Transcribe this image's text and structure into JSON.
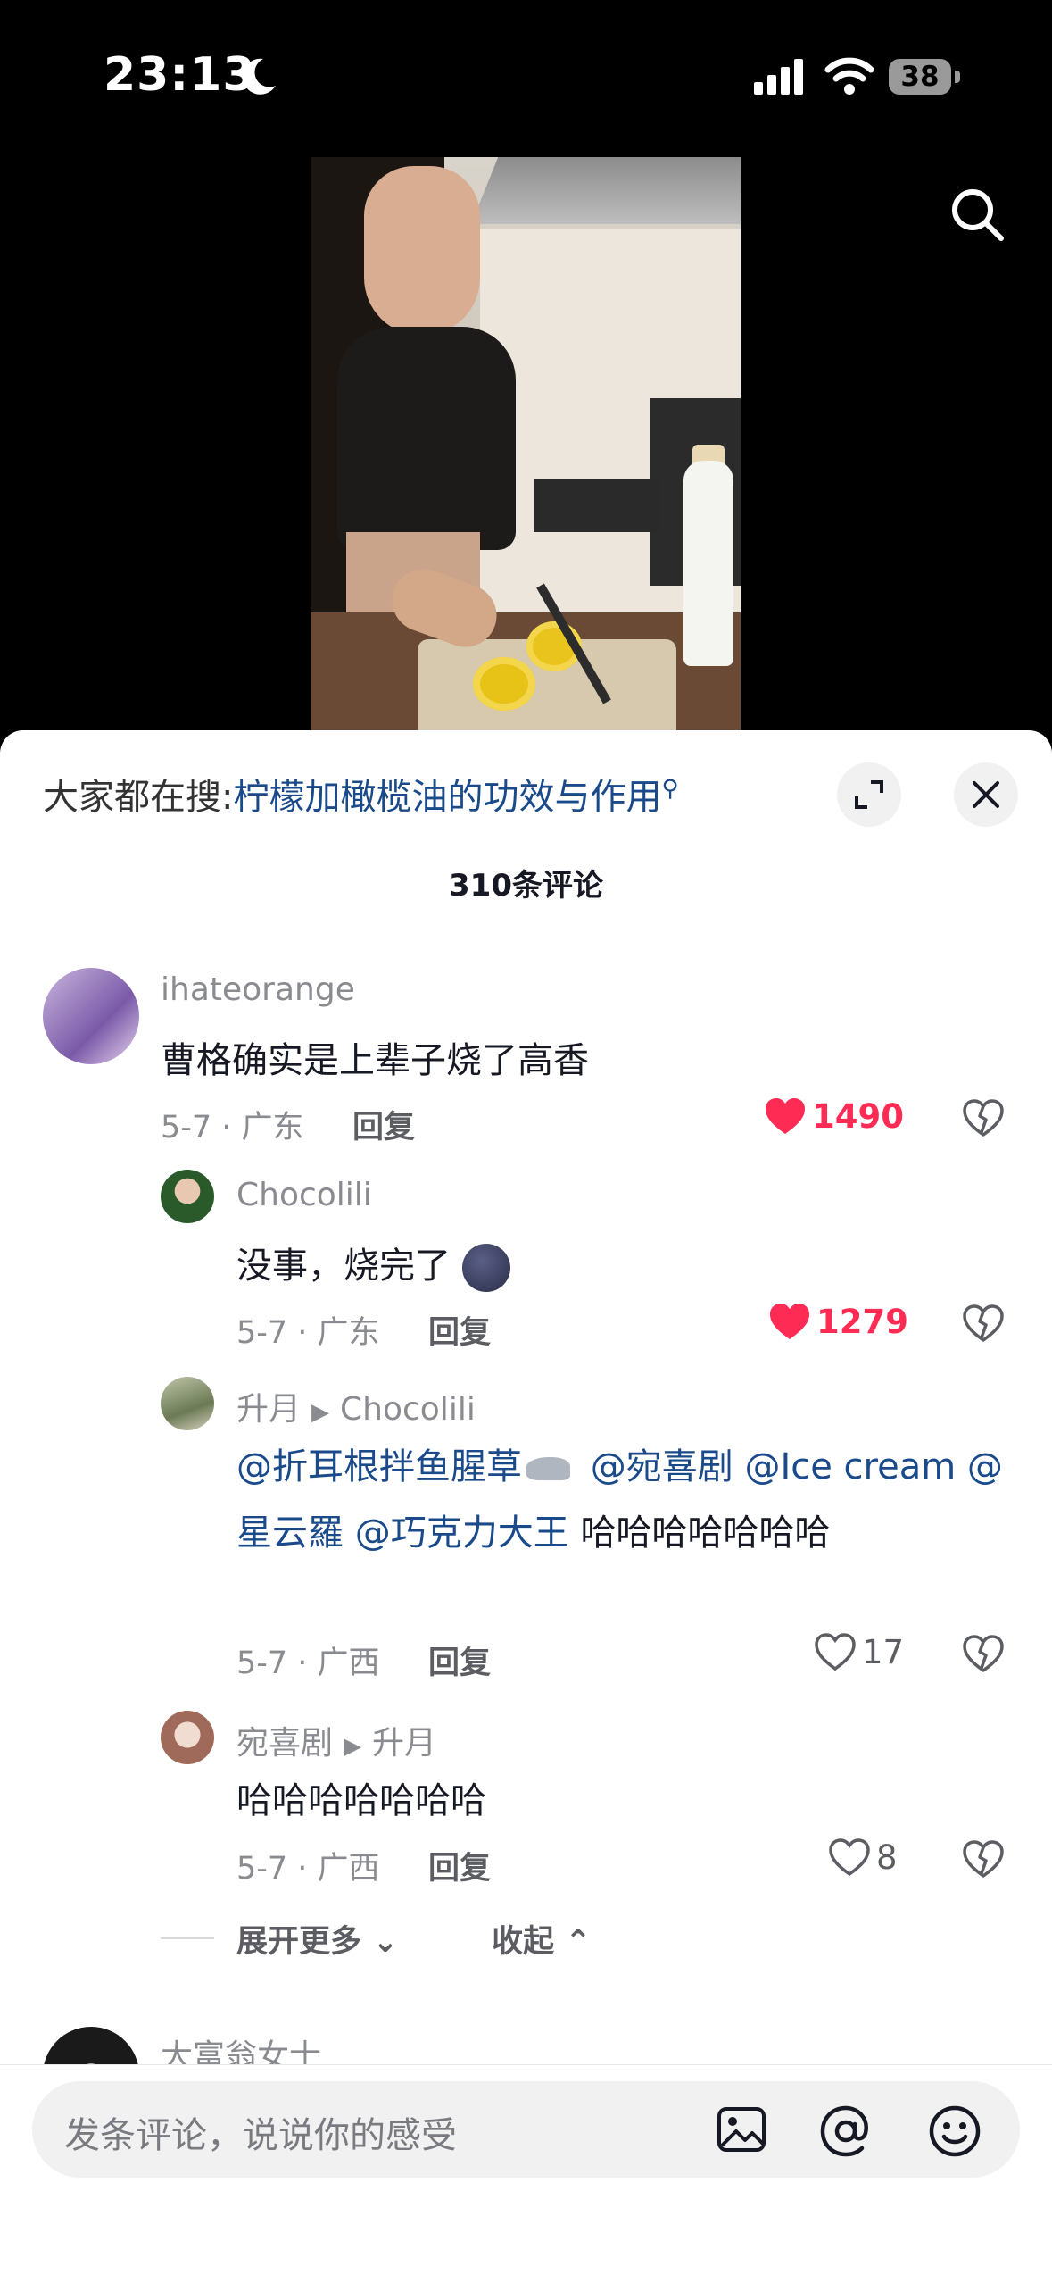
{
  "status": {
    "time": "23:13",
    "battery": "38"
  },
  "sheet": {
    "hot_label": "大家都在搜:",
    "hot_keyword": "柠檬加橄榄油的功效与作用",
    "comment_count": "310条评论",
    "comments": [
      {
        "user": "ihateorange",
        "text": "曹格确实是上辈子烧了高香",
        "meta": "5-7 · 广东",
        "reply": "回复",
        "likes": "1490"
      },
      {
        "user": "Chocolili",
        "text": "没事，烧完了",
        "meta": "5-7 · 广东",
        "reply": "回复",
        "likes": "1279"
      },
      {
        "user": "升月",
        "reply_to": "Chocolili",
        "mentions": [
          "@折耳根拌鱼腥草",
          "@宛喜剧",
          "@Ice cream",
          "@星云羅",
          "@巧克力大王"
        ],
        "tail": "哈哈哈哈哈哈哈",
        "meta": "5-7 · 广西",
        "reply": "回复",
        "likes": "17"
      },
      {
        "user": "宛喜剧",
        "reply_to": "升月",
        "text": "哈哈哈哈哈哈哈",
        "meta": "5-7 · 广西",
        "reply": "回复",
        "likes": "8"
      }
    ],
    "expand_more": "展开更多",
    "collapse": "收起",
    "next_user": "大富翁女士"
  },
  "input": {
    "placeholder": "发条评论，说说你的感受"
  }
}
